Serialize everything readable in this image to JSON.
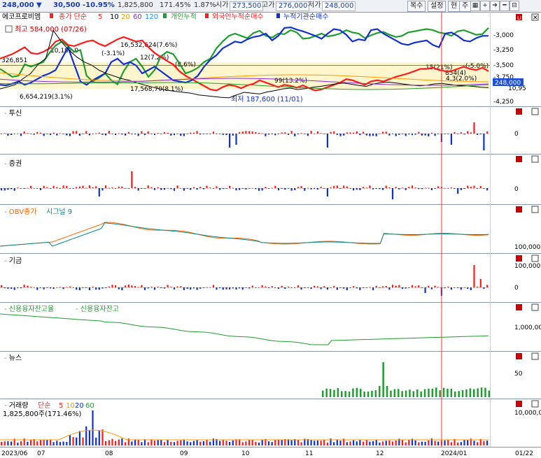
{
  "header": {
    "price": "248,000 ▼",
    "change": "30,500",
    "change_pct": "-10.95%",
    "volume": "1,825,800",
    "volume_pct": "171.45%",
    "turnover_pct": "1.87%",
    "open_label": "시가",
    "open": "273,500",
    "high_label": "고가",
    "high": "276,000",
    "low_label": "저가",
    "low": "248,000",
    "buttons": [
      "복수",
      "설정",
      "현",
      "주"
    ]
  },
  "panels": {
    "price": {
      "stock_name": "에코프로비엠",
      "ma_label": "종가 단순",
      "ma_periods": [
        "5",
        "10",
        "20",
        "60",
        "120"
      ],
      "ma_colors": [
        "#ff2020",
        "#000000",
        "#ff9900",
        "#8a2be2",
        "#1e90ff"
      ],
      "series_labels": [
        "개인누적",
        "외국인누적순매수",
        "누적기관순매수"
      ],
      "high_note": "최고 584,000 (07/26)",
      "low_note": "최저 187,600 (11/01)",
      "annotations": [
        "10,181,0",
        "16,532,624(7.6%)",
        "(-3.1%)",
        "326,851",
        "12(7.2%)",
        "(8.6%)",
        "6,654,219(3.1%)",
        "17,568,70(8.1%)",
        "99(13.2%)",
        "15(21%)",
        "854(4)",
        "(-5.0%)",
        "248,000",
        "4,3(2.0%)"
      ],
      "y_ticks": [
        "-3,000",
        "-3,250",
        "-3,500",
        "-3,750",
        "-4,000",
        "-4,250"
      ],
      "y_ticks_partial": [
        "10,95"
      ],
      "last_label": "248,000"
    },
    "trust": {
      "title": "투신",
      "zero": "0"
    },
    "securities": {
      "title": "증권",
      "zero": "0"
    },
    "obv": {
      "title": "OBV종가",
      "signal": "시그널 9",
      "tick": "100,000,",
      "colors": [
        "#ff6600",
        "#008b8b"
      ]
    },
    "other": {
      "title": "기금",
      "ticks": [
        "100,000",
        "0"
      ]
    },
    "credit": {
      "title": "신용융자잔고율",
      "title2": "신용융자잔고",
      "tick": "1,000,00"
    },
    "news": {
      "title": "뉴스",
      "tick": "50"
    },
    "volume": {
      "title": "거래량",
      "ma_label": "단순",
      "ma_periods": [
        "5",
        "10",
        "20",
        "60"
      ],
      "value": "1,825,800주(171.46%)",
      "tick": "10,000,0"
    }
  },
  "xaxis": {
    "labels": [
      "2023/06",
      "07",
      "08",
      "09",
      "10",
      "11",
      "12",
      "2024/01",
      "01/22"
    ]
  },
  "chart_data": {
    "type": "line",
    "title": "에코프로비엠",
    "price_high": 584000,
    "price_high_date": "07/26",
    "price_low": 187600,
    "price_low_date": "11/01",
    "last_price": 248000,
    "series": [
      {
        "name": "개인누적",
        "color": "#1e9e2e",
        "values": [
          -3680,
          -3750,
          -3820,
          -3800,
          -3600,
          -3640,
          -3600,
          -3560,
          -3400,
          -3270,
          -3200,
          -3280,
          -3380,
          -3350,
          -3800,
          -3900,
          -3840,
          -3760,
          -3880,
          -3950,
          -3720,
          -3560,
          -3500,
          -3640,
          -3820,
          -3700,
          -3460,
          -3380,
          -3420,
          -3580,
          -3760,
          -3720,
          -3660,
          -3560,
          -3500,
          -3320,
          -3200,
          -3100,
          -3060,
          -3100,
          -3140,
          -3050,
          -3010,
          -3100,
          -3130,
          -3060,
          -3070,
          -3000,
          -3040,
          -3150,
          -3140,
          -3100,
          -3060,
          -3110,
          -3090,
          -3060,
          -3000,
          -3040,
          -3060,
          -3140,
          -3090,
          -3050,
          -3030,
          -3080,
          -3120,
          -3100,
          -3040,
          -3020,
          -3000,
          -2980,
          -3000,
          -3040,
          -3060,
          -3100,
          -3020,
          -3000,
          -3040,
          -3080,
          -3070,
          -2960
        ]
      },
      {
        "name": "외국인누적순매수",
        "color": "#ff1a1a",
        "values": [
          -3500,
          -3460,
          -3420,
          -3360,
          -3300,
          -3400,
          -3420,
          -3380,
          -3320,
          -3200,
          -3160,
          -3260,
          -3280,
          -3240,
          -3200,
          -3180,
          -3240,
          -3280,
          -3220,
          -3160,
          -3120,
          -3160,
          -3200,
          -3180,
          -3300,
          -3400,
          -3470,
          -3540,
          -3600,
          -3720,
          -3800,
          -3860,
          -3920,
          -3980,
          -4040,
          -4060,
          -4000,
          -3960,
          -3980,
          -4020,
          -3970,
          -3940,
          -3880,
          -3920,
          -3960,
          -4000,
          -3960,
          -3980,
          -4010,
          -3970,
          -4020,
          -4060,
          -4040,
          -4000,
          -3960,
          -3920,
          -3860,
          -3880,
          -3920,
          -3960,
          -3900,
          -3880,
          -3900,
          -3860,
          -3820,
          -3790,
          -3760,
          -3720,
          -3680,
          -3680,
          -3660,
          -3700,
          -3720,
          -3720,
          -3680,
          -3640,
          -3680,
          -3700,
          -3660,
          -3720
        ]
      },
      {
        "name": "누적기관순매수",
        "color": "#1030d0",
        "values": [
          -3960,
          -3970,
          -3940,
          -3900,
          -3960,
          -3920,
          -3860,
          -3800,
          -3760,
          -3700,
          -3500,
          -3300,
          -3600,
          -3900,
          -3960,
          -3880,
          -3820,
          -3760,
          -3560,
          -3500,
          -3600,
          -3560,
          -3620,
          -3760,
          -3700,
          -3640,
          -3720,
          -3800,
          -3880,
          -3900,
          -3920,
          -3880,
          -3800,
          -3640,
          -3520,
          -3440,
          -3320,
          -3260,
          -3200,
          -3220,
          -3160,
          -3120,
          -3100,
          -3060,
          -3180,
          -3100,
          -2960,
          -2950,
          -2990,
          -3020,
          -3060,
          -3100,
          -3150,
          -3060,
          -2980,
          -3000,
          -3080,
          -3200,
          -3160,
          -3180,
          -3000,
          -2980,
          -3060,
          -3120,
          -3180,
          -3240,
          -3260,
          -3220,
          -3200,
          -3180,
          -3260,
          -3300,
          -3060,
          -3040,
          -3100,
          -3180,
          -3200,
          -3140,
          -3100,
          -3100
        ]
      },
      {
        "name": "종가",
        "color": "#000000",
        "values": [
          240,
          252,
          265,
          300,
          330,
          385,
          420,
          584,
          520,
          470,
          430,
          400,
          380,
          350,
          330,
          315,
          300,
          290,
          275,
          262,
          250,
          240,
          232,
          225,
          220,
          215,
          205,
          200,
          195,
          190,
          187.6,
          205,
          220,
          215,
          210,
          222,
          230,
          240,
          245,
          236,
          242,
          250,
          255,
          262,
          270,
          275,
          268,
          260,
          255,
          270,
          278,
          280,
          274,
          268,
          262,
          258,
          262,
          270,
          272,
          266,
          260,
          258,
          255,
          250,
          248
        ]
      }
    ],
    "ylim": [
      -4300,
      -2900
    ],
    "y_ticks": [
      -3000,
      -3250,
      -3500,
      -3750,
      -4000,
      -4250
    ]
  }
}
